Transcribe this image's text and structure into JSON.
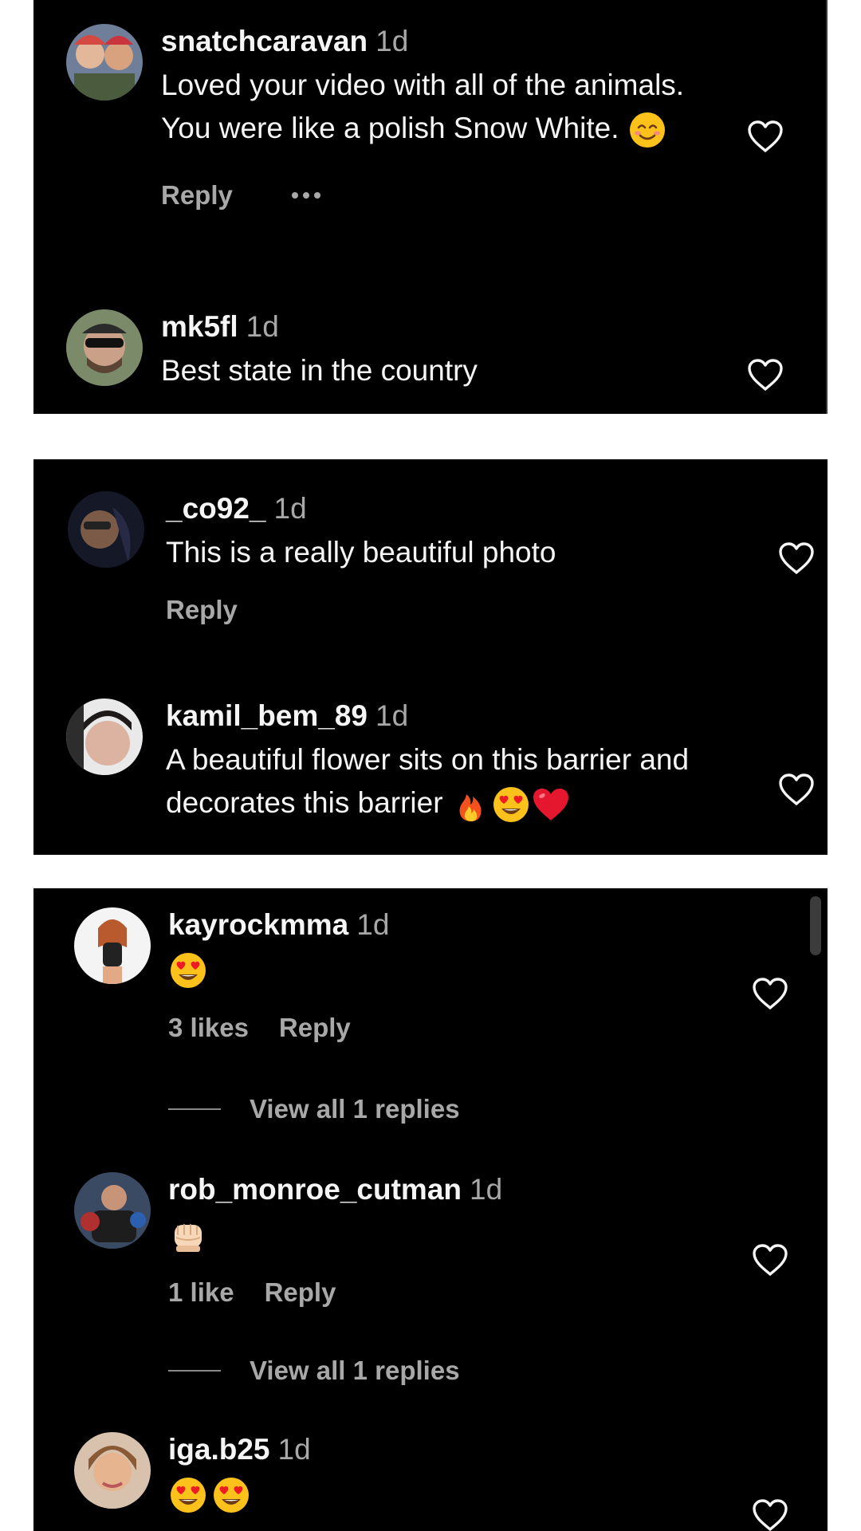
{
  "time_label": "1d",
  "reply_label": "Reply",
  "panels": [
    {
      "comments": [
        {
          "username": "snatchcaravan",
          "time": "1d",
          "text": "Loved your video with all of the animals. You were like a polish Snow White.",
          "emoji": [
            "smiling-face"
          ],
          "reply": "Reply",
          "has_more": true
        },
        {
          "username": "mk5fl",
          "time": "1d",
          "text": "Best state in the country"
        }
      ]
    },
    {
      "comments": [
        {
          "username": "_co92_",
          "time": "1d",
          "text": "This is a really beautiful photo",
          "reply": "Reply"
        },
        {
          "username": "kamil_bem_89",
          "time": "1d",
          "text": "A beautiful flower sits on this barrier and decorates this barrier",
          "emoji": [
            "fire",
            "heart-eyes",
            "red-heart"
          ]
        }
      ]
    },
    {
      "comments": [
        {
          "username": "kayrockmma",
          "time": "1d",
          "emoji": [
            "heart-eyes"
          ],
          "likes": "3 likes",
          "reply": "Reply",
          "view_replies": "View all 1 replies"
        },
        {
          "username": "rob_monroe_cutman",
          "time": "1d",
          "emoji": [
            "fist-bump"
          ],
          "likes": "1 like",
          "reply": "Reply",
          "view_replies": "View all 1 replies"
        },
        {
          "username": "iga.b25",
          "time": "1d",
          "emoji": [
            "heart-eyes",
            "heart-eyes"
          ]
        }
      ]
    }
  ],
  "colors": {
    "background": "#000000",
    "text": "#f5f5f5",
    "secondary": "#a8a8a8",
    "page": "#ffffff"
  }
}
